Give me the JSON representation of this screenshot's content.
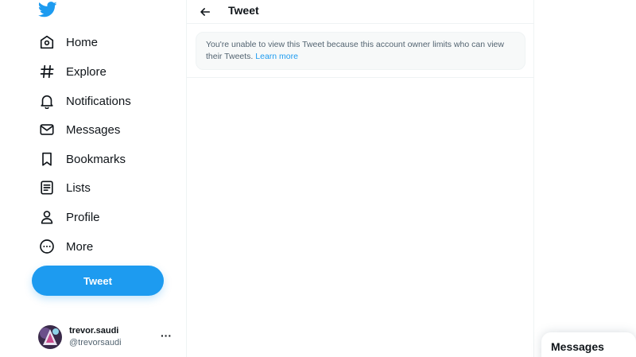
{
  "sidebar": {
    "logo_icon": "twitter-bird-icon",
    "brand_color": "#1d9bf0",
    "nav": [
      {
        "label": "Home",
        "icon": "home-icon"
      },
      {
        "label": "Explore",
        "icon": "hashtag-icon"
      },
      {
        "label": "Notifications",
        "icon": "bell-icon"
      },
      {
        "label": "Messages",
        "icon": "envelope-icon"
      },
      {
        "label": "Bookmarks",
        "icon": "bookmark-icon"
      },
      {
        "label": "Lists",
        "icon": "list-icon"
      },
      {
        "label": "Profile",
        "icon": "person-icon"
      },
      {
        "label": "More",
        "icon": "more-circle-icon"
      }
    ],
    "tweet_button": "Tweet",
    "account": {
      "name": "trevor.saudi",
      "handle": "@trevorsaudi",
      "more_icon": "ellipsis-icon",
      "more_glyph": "···"
    }
  },
  "main": {
    "title": "Tweet",
    "notice": {
      "text": "You're unable to view this Tweet because this account owner limits who can view their Tweets.",
      "link": "Learn more"
    }
  },
  "messages_drawer": {
    "title": "Messages"
  }
}
